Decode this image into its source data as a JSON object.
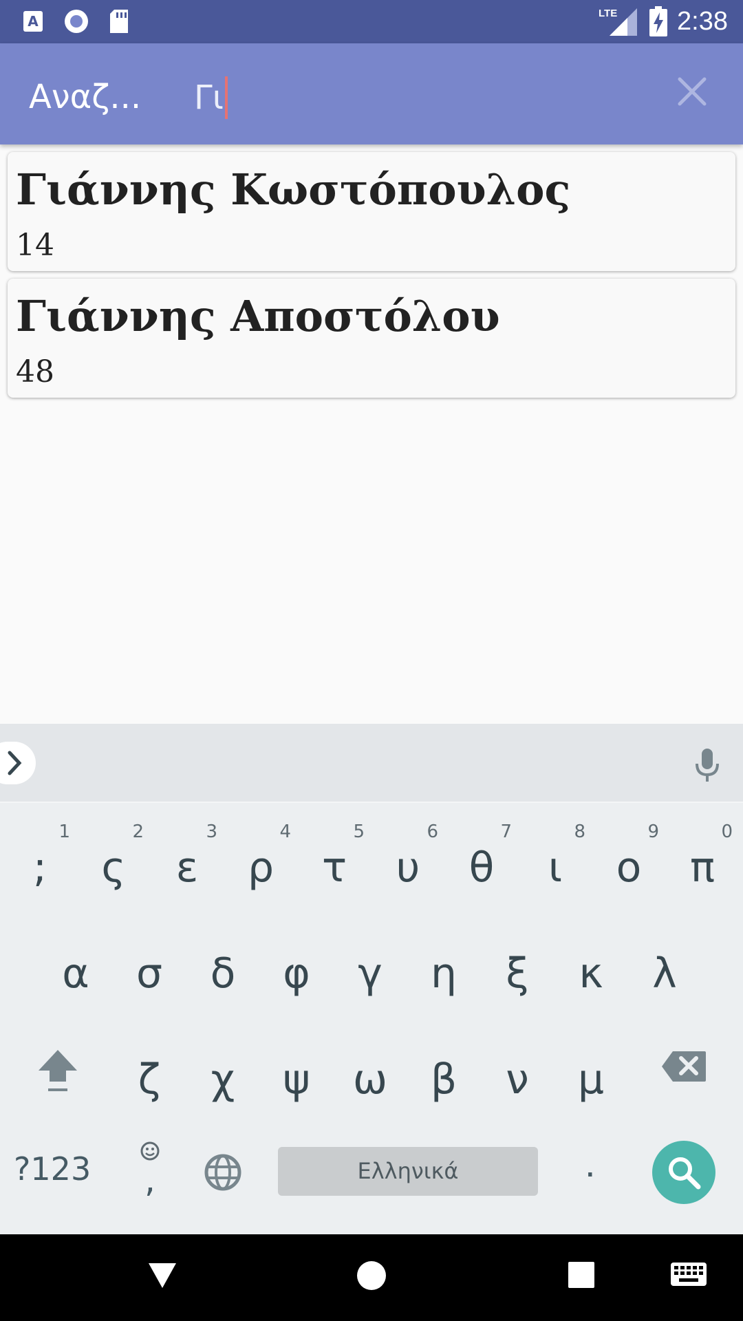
{
  "status_bar": {
    "time": "2:38",
    "network_label": "LTE",
    "icons": [
      "accessibility-icon",
      "record-icon",
      "sd-card-icon",
      "lte-signal-icon",
      "battery-charging-icon"
    ]
  },
  "appbar": {
    "title": "Αναζ...",
    "query": "Γι",
    "close_icon": "close-icon"
  },
  "results": [
    {
      "name": "Γιάννης Κωστόπουλος",
      "number": "14"
    },
    {
      "name": "Γιάννης Αποστόλου",
      "number": "48"
    }
  ],
  "keyboard": {
    "row1": [
      {
        "ch": ";",
        "hint": "1"
      },
      {
        "ch": "ς",
        "hint": "2"
      },
      {
        "ch": "ε",
        "hint": "3"
      },
      {
        "ch": "ρ",
        "hint": "4"
      },
      {
        "ch": "τ",
        "hint": "5"
      },
      {
        "ch": "υ",
        "hint": "6"
      },
      {
        "ch": "θ",
        "hint": "7"
      },
      {
        "ch": "ι",
        "hint": "8"
      },
      {
        "ch": "ο",
        "hint": "9"
      },
      {
        "ch": "π",
        "hint": "0"
      }
    ],
    "row2": [
      "α",
      "σ",
      "δ",
      "φ",
      "γ",
      "η",
      "ξ",
      "κ",
      "λ"
    ],
    "row3": [
      "ζ",
      "χ",
      "ψ",
      "ω",
      "β",
      "ν",
      "μ"
    ],
    "symbols_label": "?123",
    "emoji_comma": ",",
    "space_label": "Ελληνικά",
    "period": ".",
    "accent_color": "#4db6ac"
  },
  "navigation": {
    "icons": [
      "back-icon",
      "home-icon",
      "recents-icon",
      "keyboard-switch-icon"
    ]
  }
}
